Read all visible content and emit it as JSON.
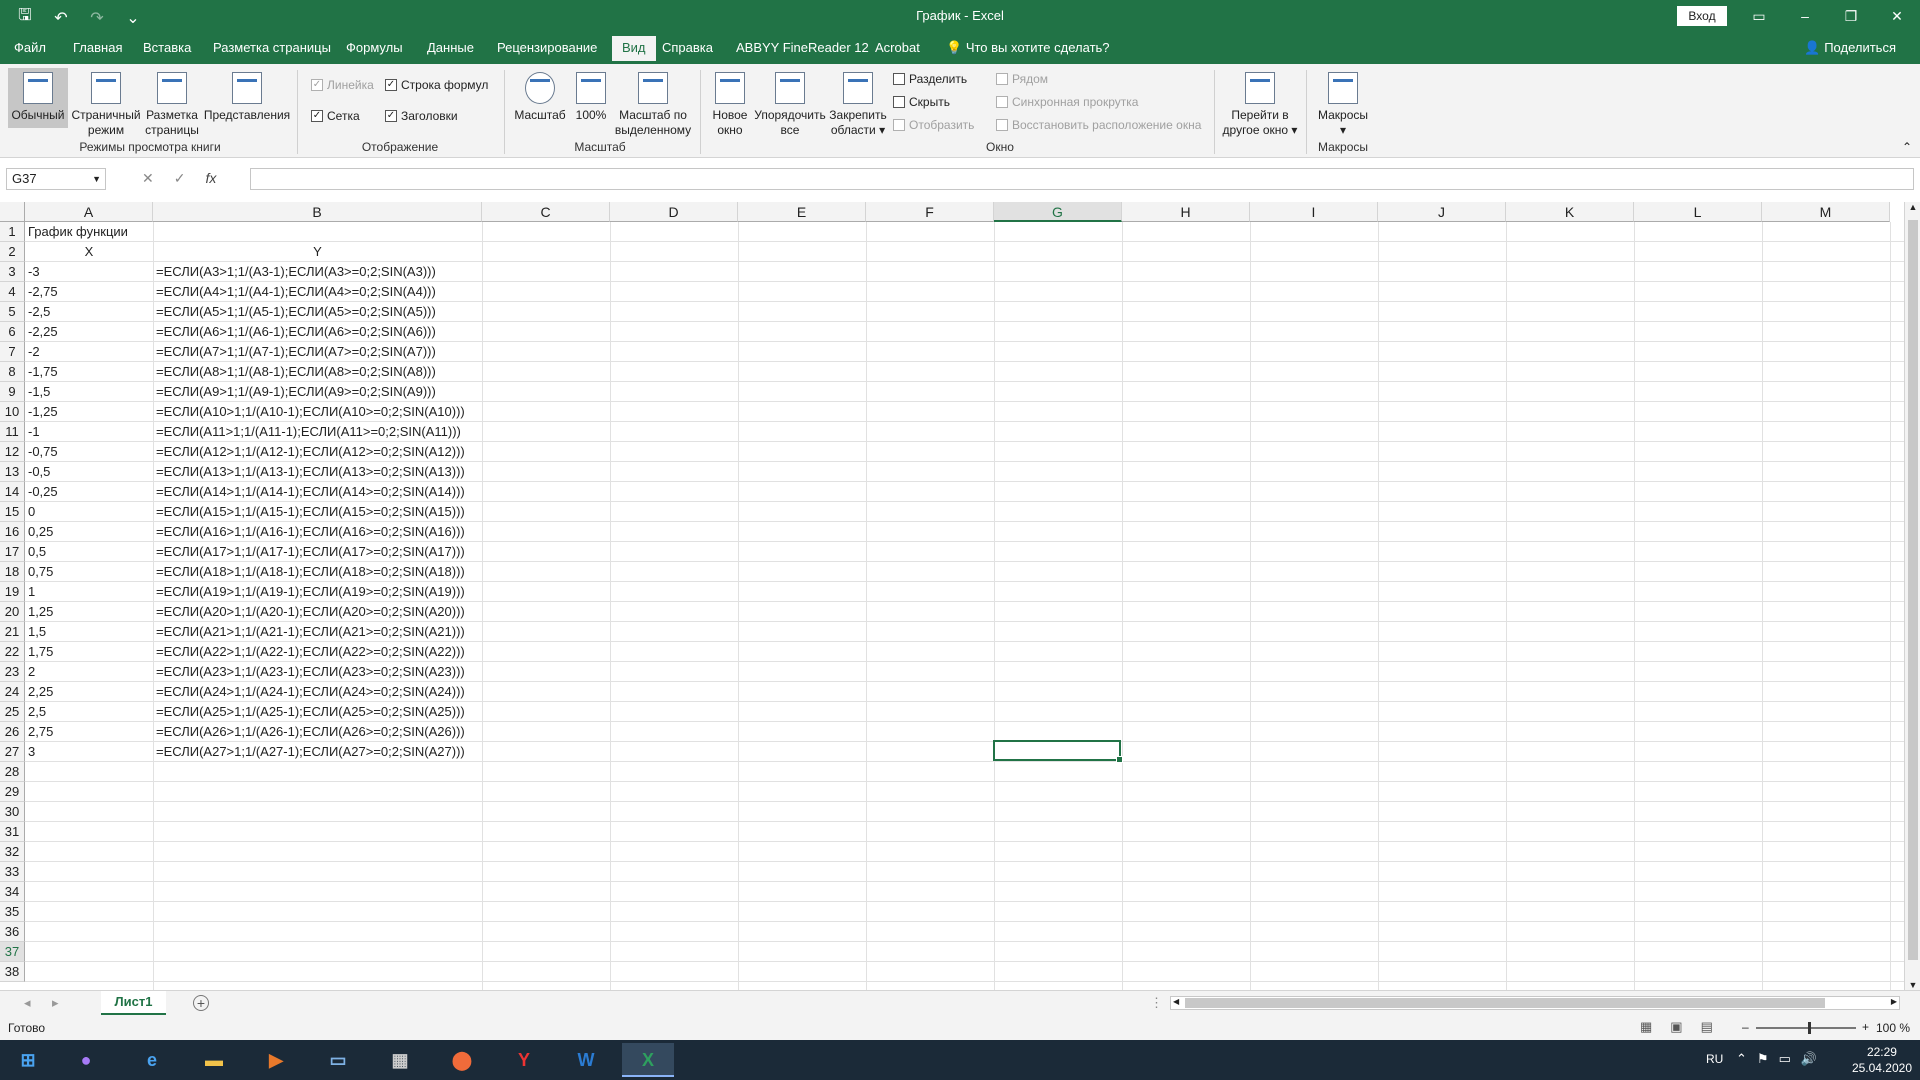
{
  "app": {
    "title": "График  -  Excel",
    "signin": "Вход"
  },
  "ribbon_tabs": [
    "Файл",
    "Главная",
    "Вставка",
    "Разметка страницы",
    "Формулы",
    "Данные",
    "Рецензирование",
    "Вид",
    "Справка",
    "ABBYY FineReader 12",
    "Acrobat"
  ],
  "tell_me": "Что вы хотите сделать?",
  "share": "Поделиться",
  "ribbon": {
    "btn_normal": "Обычный",
    "btn_pagebreak_1": "Страничный",
    "btn_pagebreak_2": "режим",
    "btn_pagelayout_1": "Разметка",
    "btn_pagelayout_2": "страницы",
    "btn_views": "Представления",
    "group_views": "Режимы просмотра книги",
    "chk_ruler": "Линейка",
    "chk_formulabar": "Строка формул",
    "chk_grid": "Сетка",
    "chk_headers": "Заголовки",
    "group_show": "Отображение",
    "btn_zoom": "Масштаб",
    "btn_100": "100%",
    "btn_zoomsel_1": "Масштаб по",
    "btn_zoomsel_2": "выделенному",
    "group_zoom": "Масштаб",
    "btn_newwin_1": "Новое",
    "btn_newwin_2": "окно",
    "btn_arrange_1": "Упорядочить",
    "btn_arrange_2": "все",
    "btn_freeze_1": "Закрепить",
    "btn_freeze_2": "области",
    "win_split": "Разделить",
    "win_hide": "Скрыть",
    "win_unhide": "Отобразить",
    "win_side": "Рядом",
    "win_sync": "Синхронная прокрутка",
    "win_reset": "Восстановить расположение окна",
    "btn_switch_1": "Перейти в",
    "btn_switch_2": "другое окно",
    "group_window": "Окно",
    "btn_macros": "Макросы",
    "group_macros": "Макросы"
  },
  "formula_bar": {
    "name_box": "G37",
    "fx": "fx",
    "value": ""
  },
  "columns": [
    "A",
    "B",
    "C",
    "D",
    "E",
    "F",
    "G",
    "H",
    "I",
    "J",
    "K",
    "L",
    "M"
  ],
  "selected_column": "G",
  "selected_row": 37,
  "rows": [
    {
      "n": "1",
      "a": "График функции",
      "b": ""
    },
    {
      "n": "2",
      "a": "X",
      "b": "Y"
    },
    {
      "n": "3",
      "a": "-3",
      "b": "=ЕСЛИ(A3>1;1/(A3-1);ЕСЛИ(A3>=0;2;SIN(A3)))"
    },
    {
      "n": "4",
      "a": "-2,75",
      "b": "=ЕСЛИ(A4>1;1/(A4-1);ЕСЛИ(A4>=0;2;SIN(A4)))"
    },
    {
      "n": "5",
      "a": "-2,5",
      "b": "=ЕСЛИ(A5>1;1/(A5-1);ЕСЛИ(A5>=0;2;SIN(A5)))"
    },
    {
      "n": "6",
      "a": "-2,25",
      "b": "=ЕСЛИ(A6>1;1/(A6-1);ЕСЛИ(A6>=0;2;SIN(A6)))"
    },
    {
      "n": "7",
      "a": "-2",
      "b": "=ЕСЛИ(A7>1;1/(A7-1);ЕСЛИ(A7>=0;2;SIN(A7)))"
    },
    {
      "n": "8",
      "a": "-1,75",
      "b": "=ЕСЛИ(A8>1;1/(A8-1);ЕСЛИ(A8>=0;2;SIN(A8)))"
    },
    {
      "n": "9",
      "a": "-1,5",
      "b": "=ЕСЛИ(A9>1;1/(A9-1);ЕСЛИ(A9>=0;2;SIN(A9)))"
    },
    {
      "n": "10",
      "a": "-1,25",
      "b": "=ЕСЛИ(A10>1;1/(A10-1);ЕСЛИ(A10>=0;2;SIN(A10)))"
    },
    {
      "n": "11",
      "a": "-1",
      "b": "=ЕСЛИ(A11>1;1/(A11-1);ЕСЛИ(A11>=0;2;SIN(A11)))"
    },
    {
      "n": "12",
      "a": "-0,75",
      "b": "=ЕСЛИ(A12>1;1/(A12-1);ЕСЛИ(A12>=0;2;SIN(A12)))"
    },
    {
      "n": "13",
      "a": "-0,5",
      "b": "=ЕСЛИ(A13>1;1/(A13-1);ЕСЛИ(A13>=0;2;SIN(A13)))"
    },
    {
      "n": "14",
      "a": "-0,25",
      "b": "=ЕСЛИ(A14>1;1/(A14-1);ЕСЛИ(A14>=0;2;SIN(A14)))"
    },
    {
      "n": "15",
      "a": "0",
      "b": "=ЕСЛИ(A15>1;1/(A15-1);ЕСЛИ(A15>=0;2;SIN(A15)))"
    },
    {
      "n": "16",
      "a": "0,25",
      "b": "=ЕСЛИ(A16>1;1/(A16-1);ЕСЛИ(A16>=0;2;SIN(A16)))"
    },
    {
      "n": "17",
      "a": "0,5",
      "b": "=ЕСЛИ(A17>1;1/(A17-1);ЕСЛИ(A17>=0;2;SIN(A17)))"
    },
    {
      "n": "18",
      "a": "0,75",
      "b": "=ЕСЛИ(A18>1;1/(A18-1);ЕСЛИ(A18>=0;2;SIN(A18)))"
    },
    {
      "n": "19",
      "a": "1",
      "b": "=ЕСЛИ(A19>1;1/(A19-1);ЕСЛИ(A19>=0;2;SIN(A19)))"
    },
    {
      "n": "20",
      "a": "1,25",
      "b": "=ЕСЛИ(A20>1;1/(A20-1);ЕСЛИ(A20>=0;2;SIN(A20)))"
    },
    {
      "n": "21",
      "a": "1,5",
      "b": "=ЕСЛИ(A21>1;1/(A21-1);ЕСЛИ(A21>=0;2;SIN(A21)))"
    },
    {
      "n": "22",
      "a": "1,75",
      "b": "=ЕСЛИ(A22>1;1/(A22-1);ЕСЛИ(A22>=0;2;SIN(A22)))"
    },
    {
      "n": "23",
      "a": "2",
      "b": "=ЕСЛИ(A23>1;1/(A23-1);ЕСЛИ(A23>=0;2;SIN(A23)))"
    },
    {
      "n": "24",
      "a": "2,25",
      "b": "=ЕСЛИ(A24>1;1/(A24-1);ЕСЛИ(A24>=0;2;SIN(A24)))"
    },
    {
      "n": "25",
      "a": "2,5",
      "b": "=ЕСЛИ(A25>1;1/(A25-1);ЕСЛИ(A25>=0;2;SIN(A25)))"
    },
    {
      "n": "26",
      "a": "2,75",
      "b": "=ЕСЛИ(A26>1;1/(A26-1);ЕСЛИ(A26>=0;2;SIN(A26)))"
    },
    {
      "n": "27",
      "a": "3",
      "b": "=ЕСЛИ(A27>1;1/(A27-1);ЕСЛИ(A27>=0;2;SIN(A27)))"
    },
    {
      "n": "28",
      "a": "",
      "b": ""
    },
    {
      "n": "29",
      "a": "",
      "b": ""
    },
    {
      "n": "30",
      "a": "",
      "b": ""
    },
    {
      "n": "31",
      "a": "",
      "b": ""
    },
    {
      "n": "32",
      "a": "",
      "b": ""
    },
    {
      "n": "33",
      "a": "",
      "b": ""
    },
    {
      "n": "34",
      "a": "",
      "b": ""
    },
    {
      "n": "35",
      "a": "",
      "b": ""
    },
    {
      "n": "36",
      "a": "",
      "b": ""
    },
    {
      "n": "37",
      "a": "",
      "b": ""
    },
    {
      "n": "38",
      "a": "",
      "b": ""
    }
  ],
  "sheet_tab": "Лист1",
  "status": {
    "text": "Готово",
    "zoom": "100 %"
  },
  "taskbar": {
    "lang": "RU",
    "time": "22:29",
    "date": "25.04.2020"
  },
  "colors": {
    "excel_green": "#217346",
    "ribbon_bg": "#f3f3f3",
    "taskbar": "#1b2a38"
  }
}
